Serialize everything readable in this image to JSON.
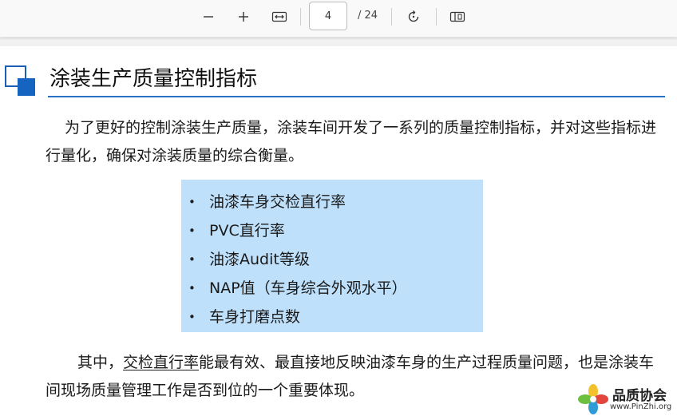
{
  "toolbar": {
    "page_current": "4",
    "page_total": "/ 24",
    "icons": [
      "zoom-out-icon",
      "zoom-in-icon",
      "fit-width-icon",
      "rotate-icon",
      "page-view-icon"
    ]
  },
  "document": {
    "title": "涂装生产质量控制指标",
    "para1": "为了更好的控制涂装生产质量，涂装车间开发了一系列的质量控制指标，并对这些指标进行量化，确保对涂装质量的综合衡量。",
    "bullets": [
      "油漆车身交检直行率",
      "PVC直行率",
      "油漆Audit等级",
      "NAP值（车身综合外观水平）",
      "车身打磨点数"
    ],
    "para2_before": "其中，",
    "para2_highlight": "交检直行率",
    "para2_after": "能最有效、最直接地反映油漆车身的生产过程质量问题，也是涂装车间现场质量管理工作是否到位的一个重要体现。"
  },
  "watermark": {
    "name": "品质协会",
    "url": "www.PinZhi.org"
  },
  "colors": {
    "accent": "#1565c0",
    "rule": "#2a72c2",
    "bullet_bg": "#bfe0fb"
  }
}
